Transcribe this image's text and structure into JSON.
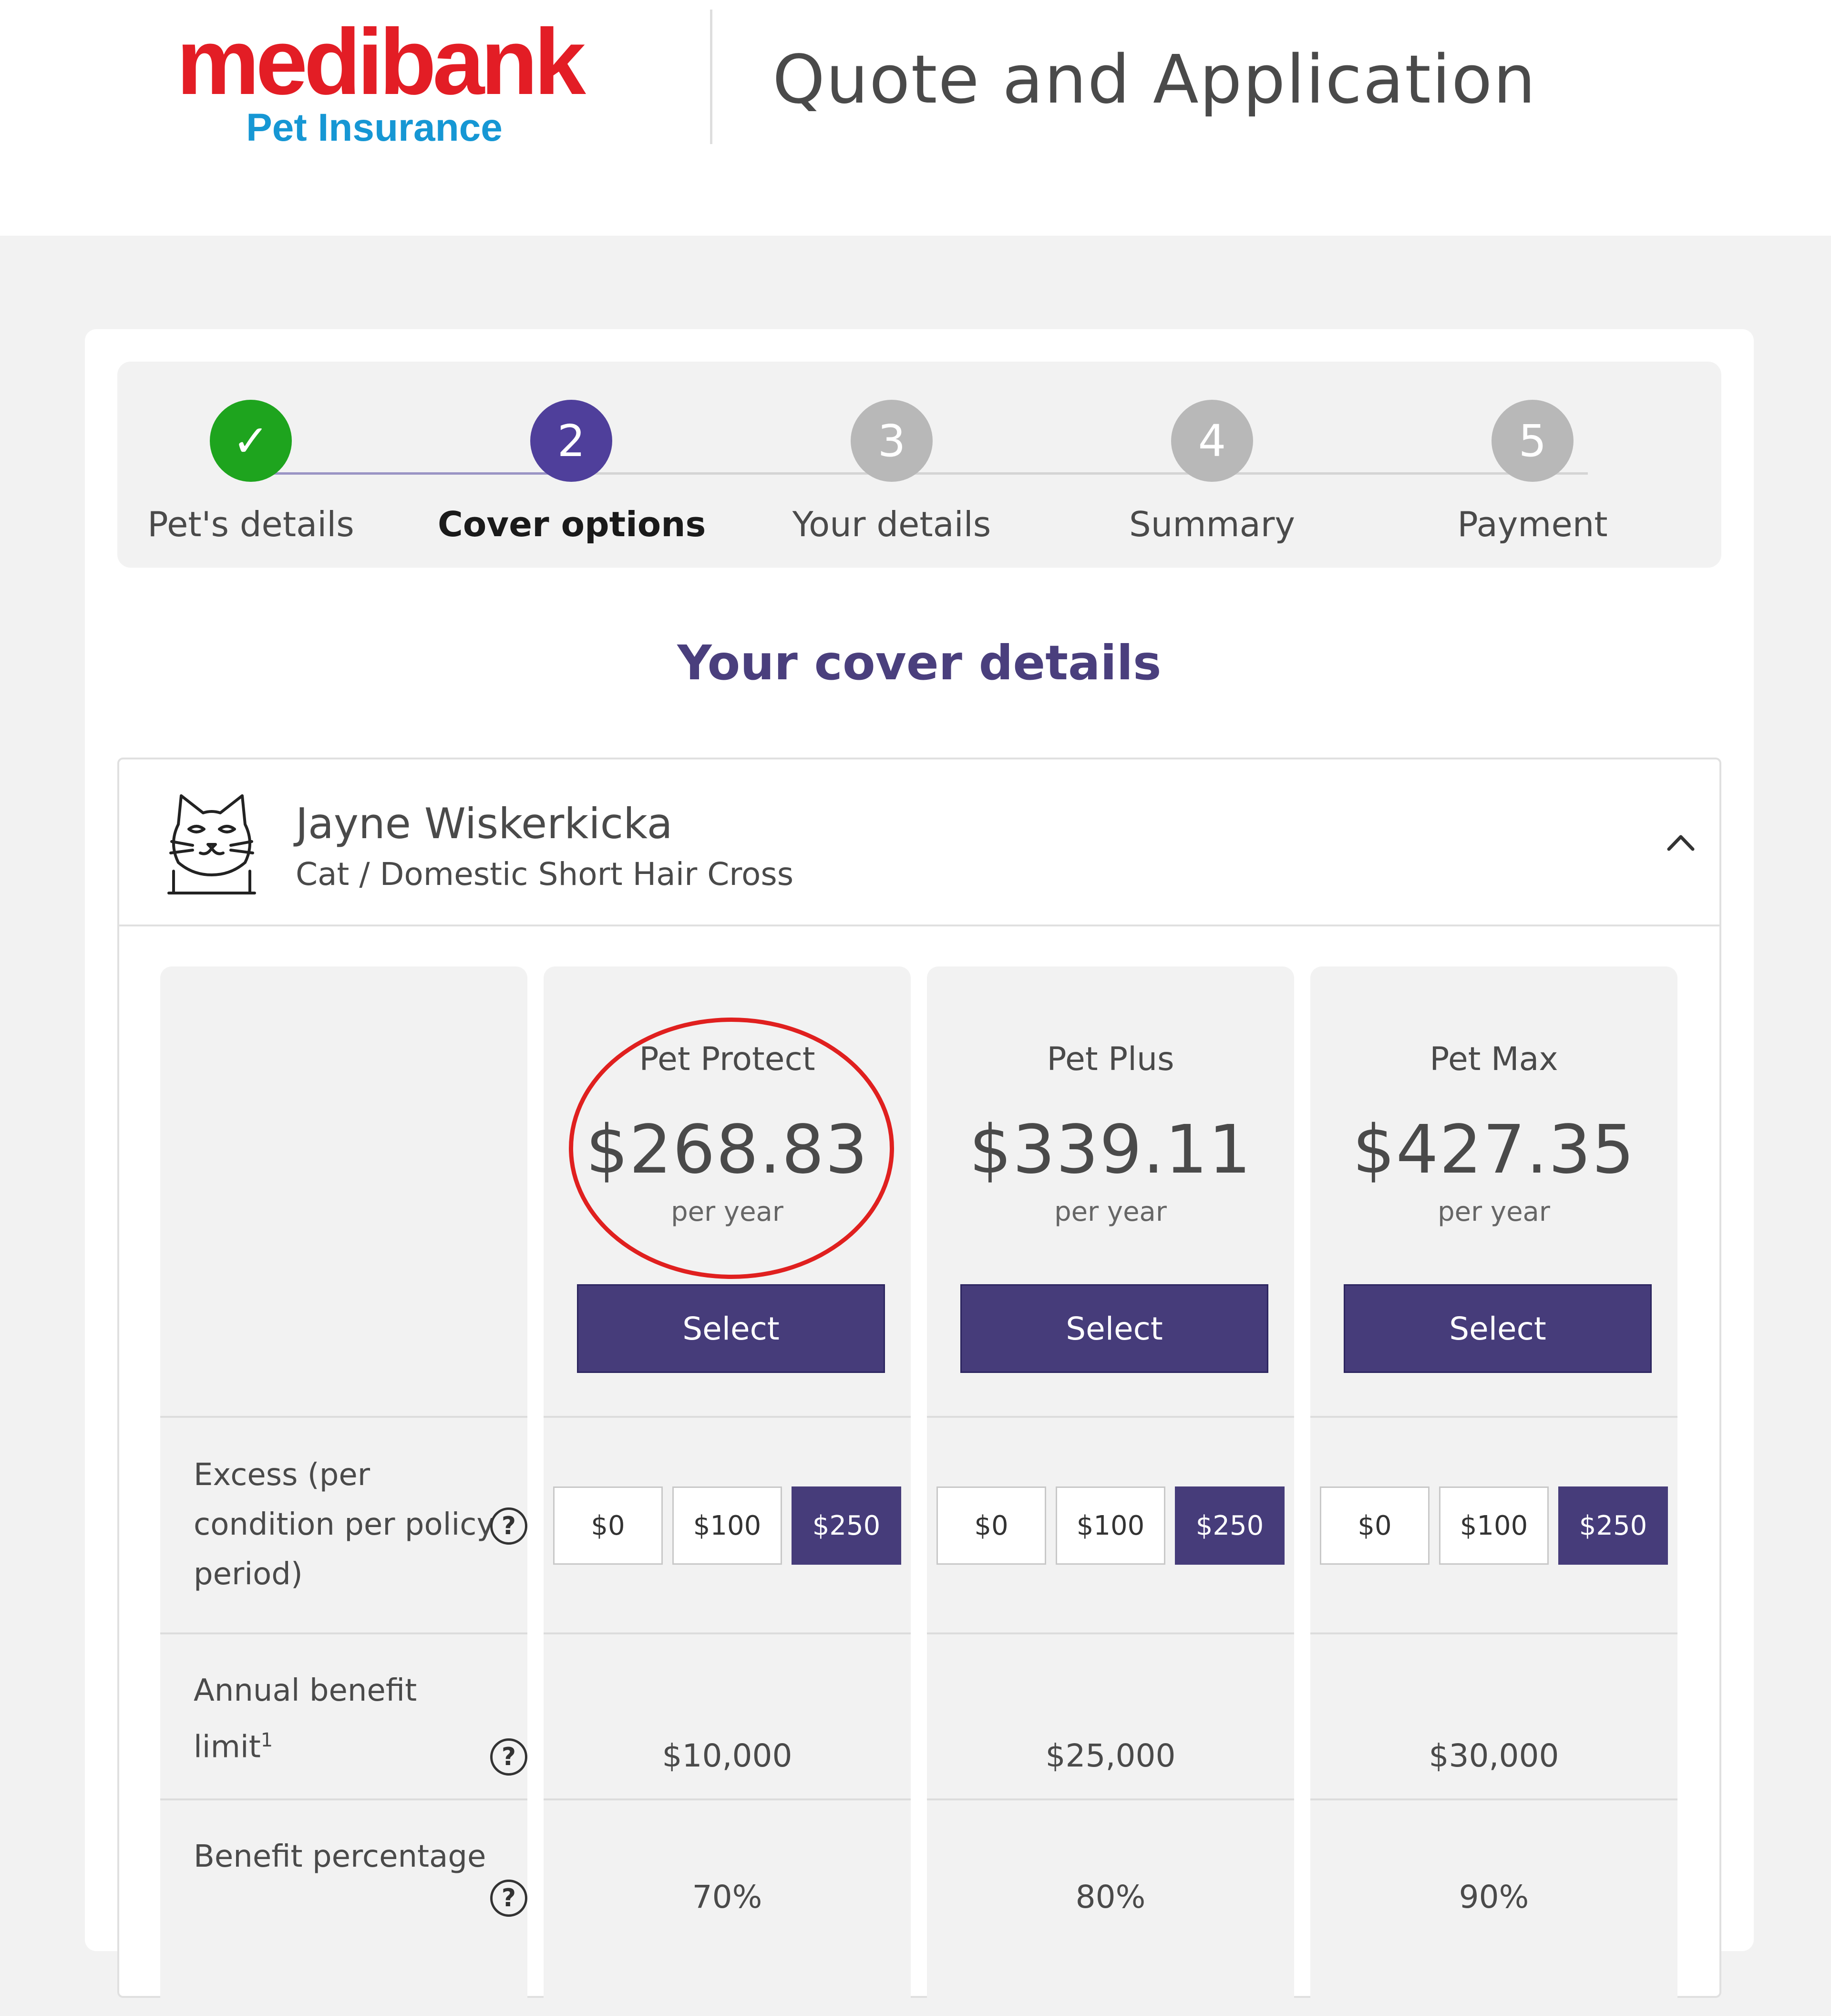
{
  "brand": {
    "name": "medibank",
    "subtitle": "Pet Insurance",
    "colors": {
      "red": "#e31d25",
      "blue": "#1697d4",
      "purple": "#463c7a",
      "green": "#1ea41e"
    }
  },
  "header": {
    "title": "Quote and Application"
  },
  "stepper": {
    "steps": [
      {
        "marker": "✓",
        "label": "Pet's details",
        "state": "complete"
      },
      {
        "marker": "2",
        "label": "Cover options",
        "state": "current"
      },
      {
        "marker": "3",
        "label": "Your details",
        "state": "upcoming"
      },
      {
        "marker": "4",
        "label": "Summary",
        "state": "upcoming"
      },
      {
        "marker": "5",
        "label": "Payment",
        "state": "upcoming"
      }
    ]
  },
  "section": {
    "title": "Your cover details"
  },
  "pet": {
    "name": "Jayne Wiskerkicka",
    "breed": "Cat / Domestic Short Hair Cross",
    "avatar_icon": "cat-icon",
    "toggle_icon": "chevron-up-icon"
  },
  "plans": [
    {
      "name": "Pet Protect",
      "price": "$268.83",
      "period": "per year",
      "select_label": "Select",
      "excess": [
        "$0",
        "$100",
        "$250"
      ],
      "excess_selected": "$250",
      "annual_limit": "$10,000",
      "benefit_pct": "70%"
    },
    {
      "name": "Pet Plus",
      "price": "$339.11",
      "period": "per year",
      "select_label": "Select",
      "excess": [
        "$0",
        "$100",
        "$250"
      ],
      "excess_selected": "$250",
      "annual_limit": "$25,000",
      "benefit_pct": "80%"
    },
    {
      "name": "Pet Max",
      "price": "$427.35",
      "period": "per year",
      "select_label": "Select",
      "excess": [
        "$0",
        "$100",
        "$250"
      ],
      "excess_selected": "$250",
      "annual_limit": "$30,000",
      "benefit_pct": "90%"
    }
  ],
  "rows": {
    "excess": {
      "line1": "Excess (per",
      "line2": "condition per policy",
      "line3": "period)"
    },
    "annual_limit": {
      "line1": "Annual benefit",
      "line2": "limit",
      "sup": "1"
    },
    "benefit_pct": {
      "line1": "Benefit percentage"
    },
    "help_glyph": "?"
  }
}
